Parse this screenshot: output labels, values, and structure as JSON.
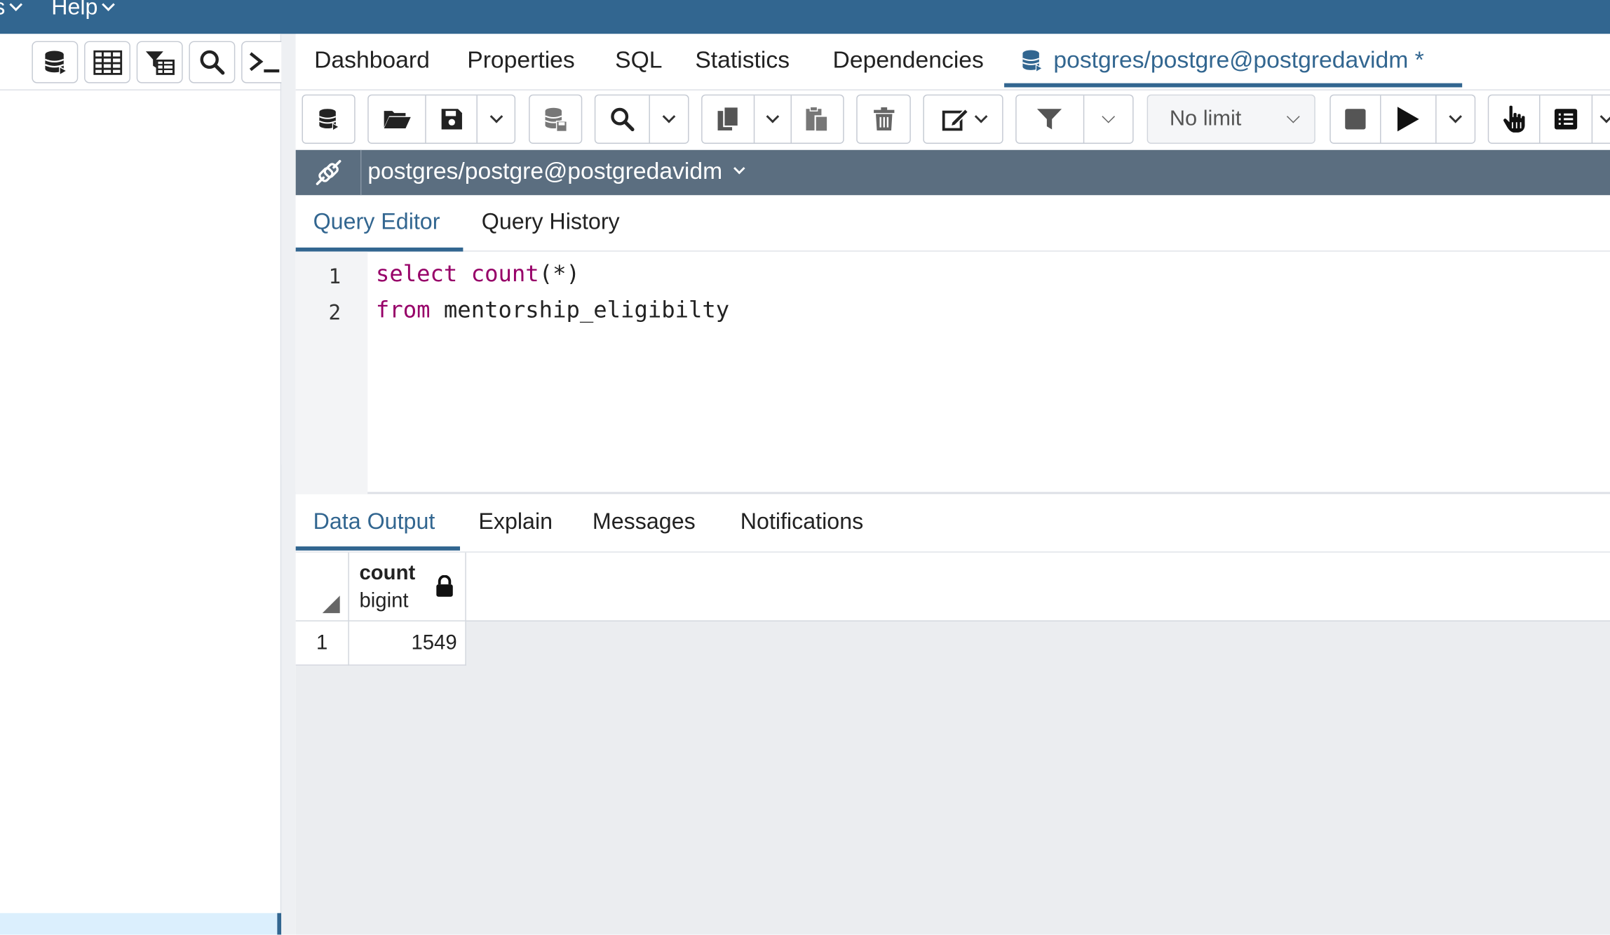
{
  "menubar": {
    "partial_menu": "s",
    "help": "Help"
  },
  "main_tabs": [
    {
      "label": "Dashboard"
    },
    {
      "label": "Properties"
    },
    {
      "label": "SQL"
    },
    {
      "label": "Statistics"
    },
    {
      "label": "Dependencies"
    },
    {
      "label": "postgres/postgre@postgredavidm *"
    }
  ],
  "query_toolbar": {
    "limit_value": "No limit"
  },
  "connection": {
    "label": "postgres/postgre@postgredavidm"
  },
  "editor_tabs": [
    {
      "label": "Query Editor"
    },
    {
      "label": "Query History"
    }
  ],
  "editor": {
    "lines": [
      {
        "number": "1",
        "keyword1": "select",
        "keyword2": "count",
        "rest": "(*)"
      },
      {
        "number": "2",
        "keyword1": "from",
        "rest": " mentorship_eligibilty"
      }
    ]
  },
  "output_tabs": [
    {
      "label": "Data Output"
    },
    {
      "label": "Explain"
    },
    {
      "label": "Messages"
    },
    {
      "label": "Notifications"
    }
  ],
  "result": {
    "columns": [
      {
        "name": "count",
        "type": "bigint"
      }
    ],
    "rows": [
      {
        "num": "1",
        "values": [
          "1549"
        ]
      }
    ]
  },
  "colors": {
    "menubar": "#326690",
    "accent": "#326690",
    "connbar": "#5b6e80",
    "keyword": "#970068",
    "grid_bg": "#ebedf0"
  }
}
